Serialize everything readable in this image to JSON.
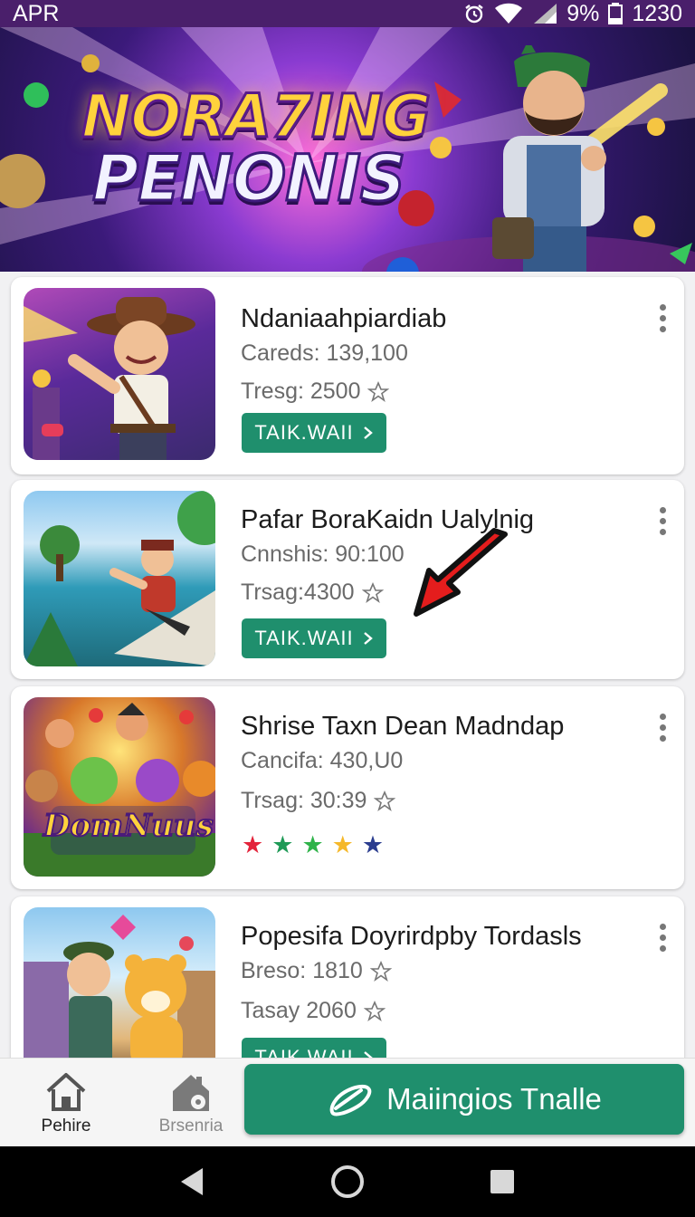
{
  "status_bar": {
    "left": "APR",
    "battery": "9%",
    "time": "1230"
  },
  "hero": {
    "title_line1": "NORA7ING",
    "title_line2": "PENONIS"
  },
  "games": [
    {
      "title": "Ndaniaahpiardiab",
      "line1": "Careds: 139,100",
      "line2": "Tresg: 2500",
      "button": "TAIK.WAII",
      "thumb_icon": "cowboy-character-icon"
    },
    {
      "title": "Pafar BoraKaidn Ualylnig",
      "line1": "Cnnshis: 90:100",
      "line2": "Trsag:4300",
      "button": "TAIK.WAII",
      "thumb_icon": "pool-character-icon"
    },
    {
      "title": "Shrise Taxn Dean Madndap",
      "line1": "Cancifa: 430,U0",
      "line2": "Trsag: 30:39",
      "thumb_text": "DomNuus",
      "rating_colors": [
        "#e3243b",
        "#1f9a57",
        "#2fb34a",
        "#f5b82a",
        "#2b3d8f"
      ],
      "thumb_icon": "group-characters-icon"
    },
    {
      "title": "Popesifa Doyrirdpby Tordasls",
      "line1": "Breso: 1810",
      "line2": "Tasay 2060",
      "button": "TAIK.WAII",
      "thumb_icon": "bear-character-icon"
    }
  ],
  "bottom_nav": {
    "home_label": "Pehire",
    "second_label": "Brsenria",
    "cta_label": "Maiingios Tnalle"
  },
  "colors": {
    "accent": "#1f8f6d",
    "status_bar": "#4a1f6b",
    "arrow": "#e41d1d"
  }
}
